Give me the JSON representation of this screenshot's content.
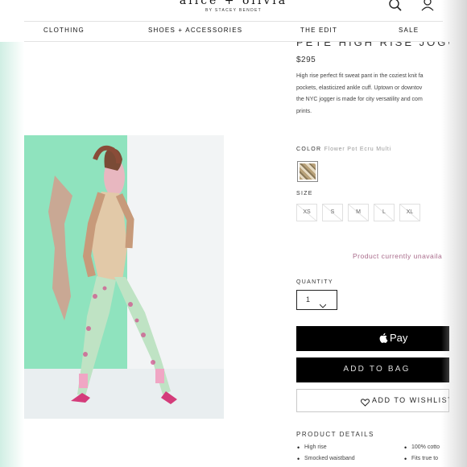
{
  "header": {
    "brand": "alice + olivia",
    "brand_sub": "BY STACEY BENDET",
    "icons": [
      "search-icon",
      "user-icon"
    ]
  },
  "nav": {
    "items": [
      {
        "label": "CLOTHING"
      },
      {
        "label": "SHOES + ACCESSORIES"
      },
      {
        "label": "THE EDIT"
      },
      {
        "label": "SALE"
      }
    ]
  },
  "product": {
    "title": "PETE HIGH RISE JOGGER",
    "price": "$295",
    "description": [
      "High rise perfect fit sweat pant in the coziest knit fa",
      "pockets, elasticized ankle cuff. Uptown or downtov",
      "the NYC jogger is made for city versatility and com",
      "prints."
    ],
    "color_label": "COLOR",
    "color_value": "Flower Pot Ecru Multi",
    "size_label": "SIZE",
    "sizes": [
      "XS",
      "S",
      "M",
      "L",
      "XL"
    ],
    "availability": "Product currently unavaila",
    "quantity_label": "QUANTITY",
    "quantity_value": "1",
    "apple_pay_label": "Pay",
    "add_to_bag_label": "ADD TO BAG",
    "wishlist_label": "ADD TO WISHLIST",
    "details_heading": "PRODUCT DETAILS",
    "details": [
      "High rise",
      "Smocked waistband",
      "100% cotto",
      "Fits true to"
    ]
  },
  "colors": {
    "photo_background": "#8fe3be",
    "add_to_bag_text": "#dddddd",
    "availability_text": "#a86a8a"
  }
}
